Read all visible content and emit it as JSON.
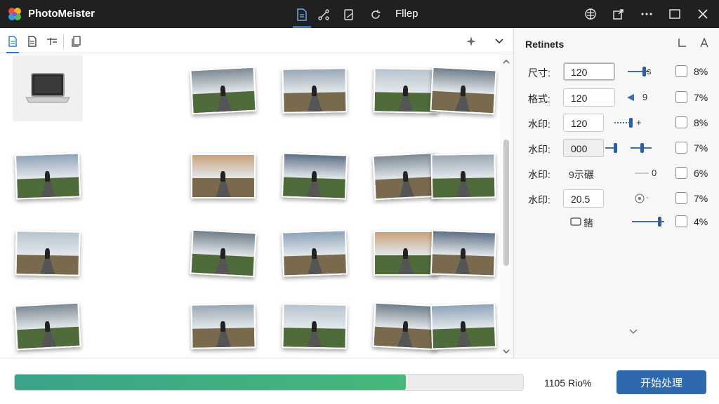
{
  "app": {
    "title": "PhotoMeister",
    "file_label": "Fllep"
  },
  "colors": {
    "accent": "#2b7bd3",
    "primary_button": "#2f68ac",
    "progress_fill": "#3aa389",
    "titlebar": "#202020"
  },
  "toolbar_icons": [
    "document-icon",
    "share-nodes-icon",
    "edit-page-icon",
    "rotate-icon"
  ],
  "window_icons": [
    "brain-icon",
    "export-icon",
    "more-icon",
    "maximize-icon",
    "close-icon"
  ],
  "left_toolbar_icons": [
    "document-icon",
    "file-lines-icon",
    "sliders-icon",
    "stack-icon",
    "sparkle-icon",
    "chevron-down-icon"
  ],
  "panel": {
    "title": "Retinets",
    "rows": [
      {
        "label": "尺寸:",
        "value": "120",
        "slider_value": "s",
        "percent": "8%"
      },
      {
        "label": "格式:",
        "value": "120",
        "slider_value": "9",
        "percent": "7%"
      },
      {
        "label": "水印:",
        "value": "120",
        "slider_value": "+",
        "percent": "8%"
      },
      {
        "label": "水印:",
        "value": "000",
        "slider_value": "",
        "percent": "7%"
      },
      {
        "label": "水印:",
        "value": "9示碾",
        "slider_value": "0",
        "percent": "6%"
      },
      {
        "label": "水印:",
        "value": "20.5",
        "slider_value": "",
        "percent": "7%"
      },
      {
        "label": "",
        "value": "鍺",
        "slider_value": "",
        "percent": "4%"
      }
    ]
  },
  "bottom": {
    "progress_percent": 77,
    "progress_text": "1105 Rio%",
    "start_label": "开始处理"
  }
}
